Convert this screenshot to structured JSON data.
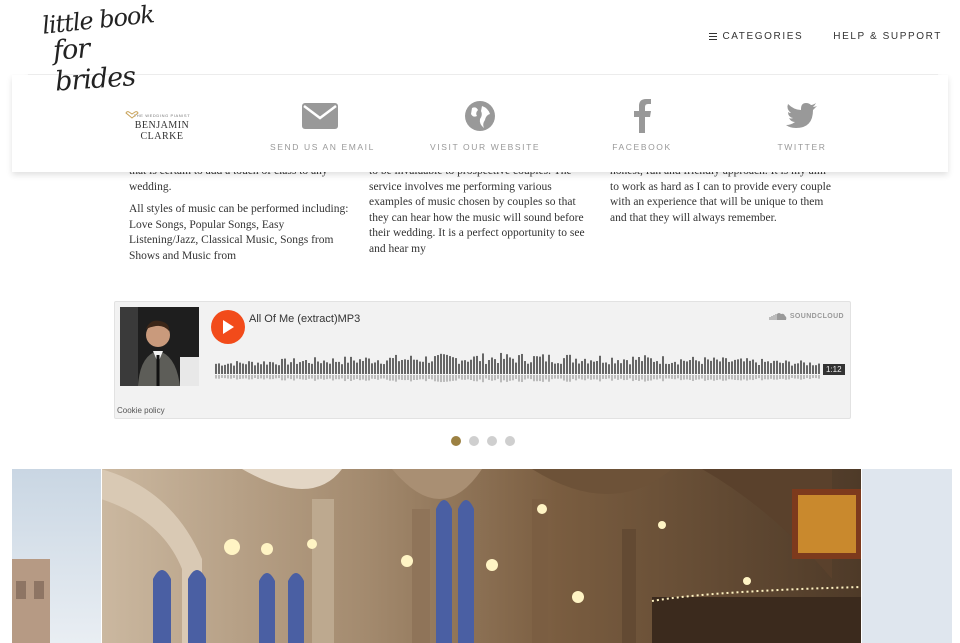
{
  "site": {
    "logo_line1": "little book",
    "logo_line2": "for brides"
  },
  "nav": {
    "categories": "CATEGORIES",
    "help": "HELP & SUPPORT"
  },
  "contact": {
    "brand_small": "THE WEDDING PIANIST",
    "brand_name": "BENJAMIN CLARKE",
    "email": "SEND US AN EMAIL",
    "website": "VISIT OUR WEBSITE",
    "facebook": "FACEBOOK",
    "twitter": "TWITTER"
  },
  "columns": {
    "col1_p1": "that is certain to add a touch of class to any wedding.",
    "col1_p2": "All styles of music can be performed including: Love Songs, Popular Songs, Easy Listening/Jazz, Classical Music, Songs from Shows and Music from",
    "col2_p1": "to be invaluable to prospective couples. The service involves me performing various examples of music chosen by couples so that they can hear how the music will sound before their wedding. It is a perfect opportunity to see and hear my",
    "col3_p1": "honest, fun and friendly approach. It is my aim to work as hard as I can to provide every couple with an experience that will be unique to them and that they will always remember."
  },
  "player": {
    "track_title": "All Of Me (extract)MP3",
    "brand": "SOUNDCLOUD",
    "duration": "1:12",
    "cookie": "Cookie policy",
    "accent": "#f24b1a"
  },
  "carousel": {
    "active_index": 0,
    "count": 4,
    "active_color": "#9c8142"
  }
}
